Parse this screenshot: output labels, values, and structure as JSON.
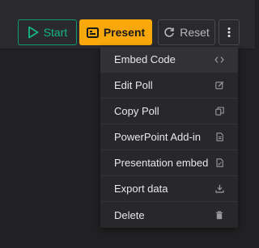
{
  "toolbar": {
    "start_label": "Start",
    "present_label": "Present",
    "reset_label": "Reset"
  },
  "colors": {
    "start_green": "#14b784",
    "present_orange": "#f8a80a",
    "menu_bg": "#28282a"
  },
  "menu": {
    "items": [
      {
        "label": "Embed Code",
        "icon": "code-icon"
      },
      {
        "label": "Edit Poll",
        "icon": "edit-icon"
      },
      {
        "label": "Copy Poll",
        "icon": "copy-icon"
      },
      {
        "label": "PowerPoint Add-in",
        "icon": "file-icon"
      },
      {
        "label": "Presentation embed",
        "icon": "document-icon"
      },
      {
        "label": "Export data",
        "icon": "download-icon"
      },
      {
        "label": "Delete",
        "icon": "trash-icon"
      }
    ]
  }
}
